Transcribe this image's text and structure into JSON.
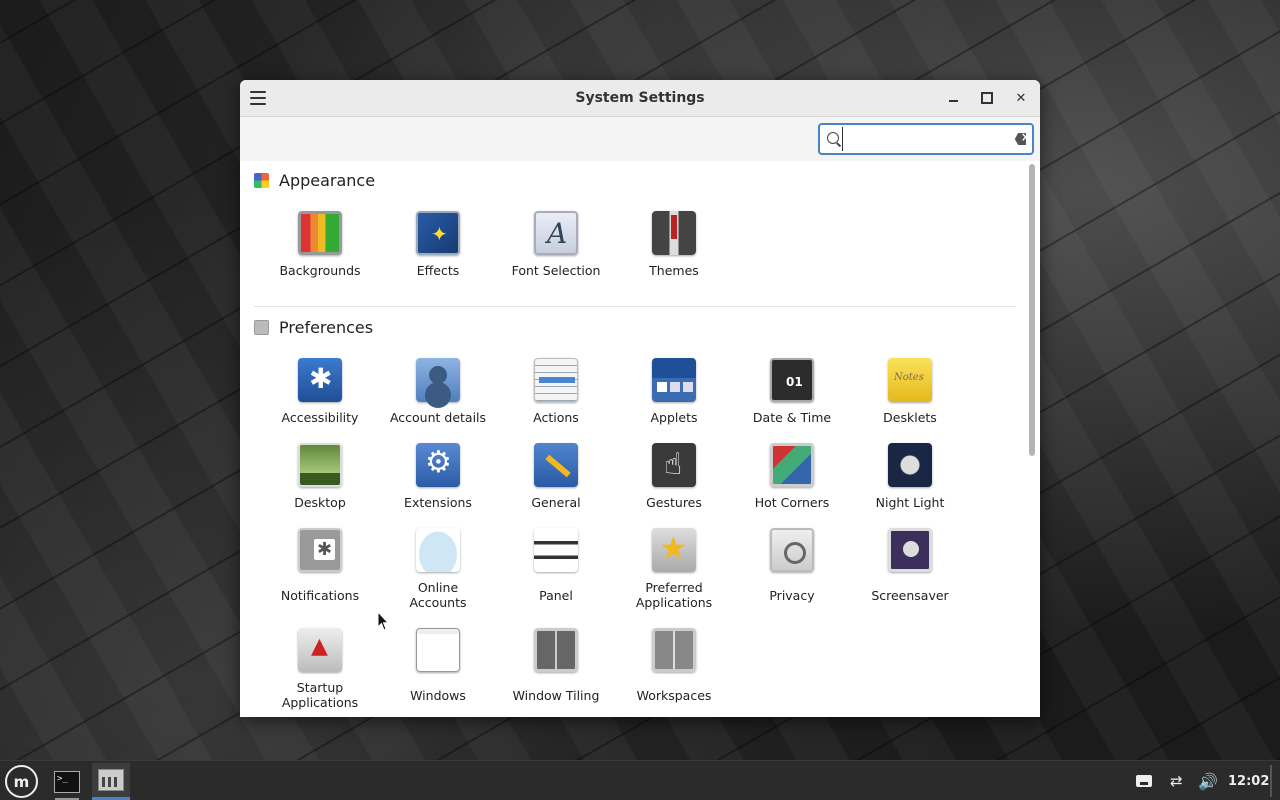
{
  "window": {
    "title": "System Settings"
  },
  "search": {
    "value": "",
    "placeholder": ""
  },
  "sections": {
    "appearance": {
      "title": "Appearance",
      "items": [
        "Backgrounds",
        "Effects",
        "Font Selection",
        "Themes"
      ]
    },
    "preferences": {
      "title": "Preferences",
      "items": [
        "Accessibility",
        "Account details",
        "Actions",
        "Applets",
        "Date & Time",
        "Desklets",
        "Desktop",
        "Extensions",
        "General",
        "Gestures",
        "Hot Corners",
        "Night Light",
        "Notifications",
        "Online Accounts",
        "Panel",
        "Preferred Applications",
        "Privacy",
        "Screensaver",
        "Startup Applications",
        "Windows",
        "Window Tiling",
        "Workspaces"
      ]
    }
  },
  "taskbar": {
    "clock": "12:02",
    "term_prompt": ">_",
    "menu_glyph": "m",
    "network_glyph": "⇄",
    "volume_glyph": "🔊"
  },
  "colors": {
    "accent": "#4b82c4",
    "titlebar": "#ebebeb",
    "panel": "#2b2b2b"
  }
}
